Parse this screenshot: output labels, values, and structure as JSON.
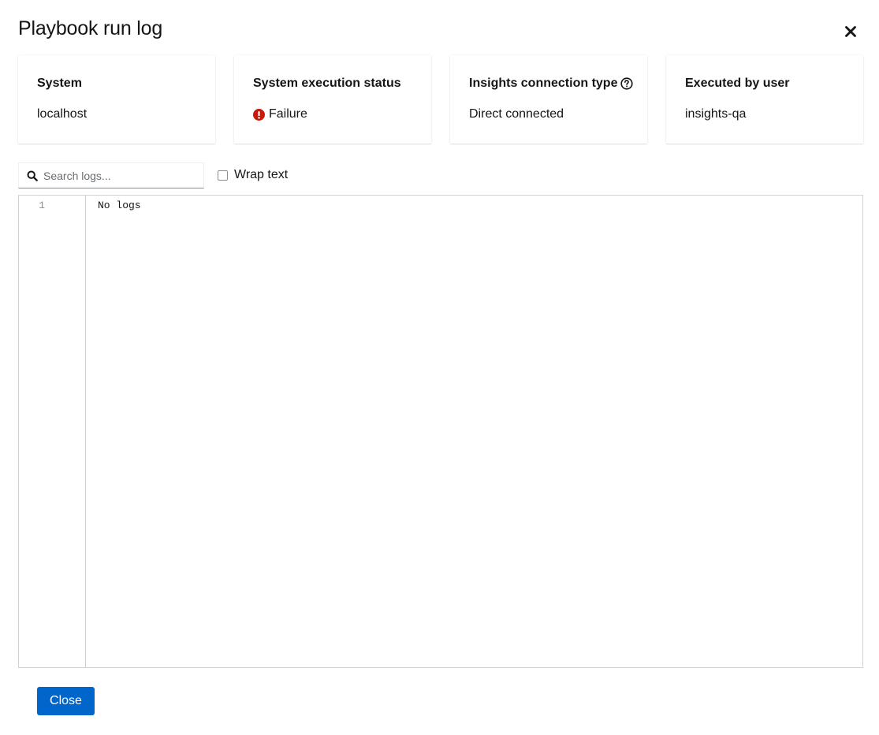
{
  "modal": {
    "title": "Playbook run log",
    "close_icon": "close-icon"
  },
  "cards": [
    {
      "title": "System",
      "value": "localhost"
    },
    {
      "title": "System execution status",
      "value": "Failure",
      "status_icon": "exclamation-circle-icon",
      "status_color": "#c9190b"
    },
    {
      "title": "Insights connection type",
      "value": "Direct connected",
      "help_icon": "question-circle-icon"
    },
    {
      "title": "Executed by user",
      "value": "insights-qa"
    }
  ],
  "search": {
    "placeholder": "Search logs...",
    "value": "",
    "icon": "search-icon"
  },
  "wrap_text": {
    "label": "Wrap text",
    "checked": false
  },
  "log": {
    "lines": [
      {
        "number": "1",
        "text": "No logs"
      }
    ]
  },
  "footer": {
    "close_label": "Close"
  },
  "colors": {
    "primary": "#0066cc",
    "danger": "#c9190b",
    "border": "#d2d2d2"
  }
}
